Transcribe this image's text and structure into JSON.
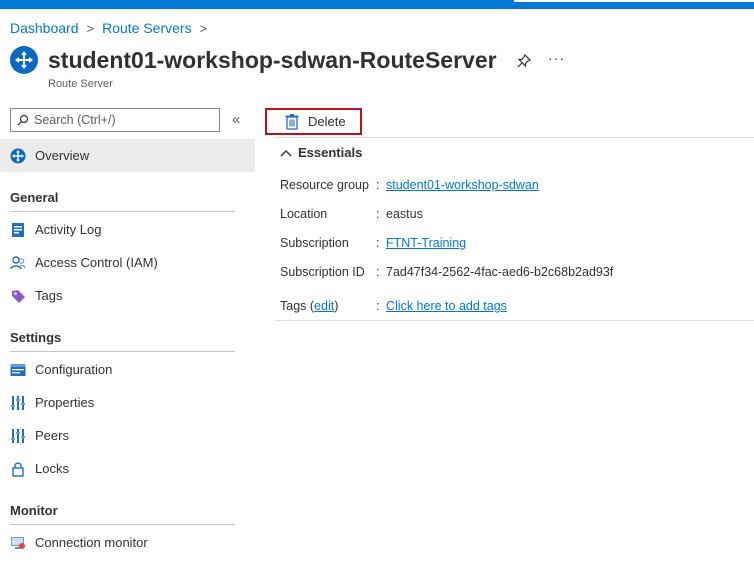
{
  "breadcrumb": {
    "items": [
      "Dashboard",
      "Route Servers"
    ],
    "separator": ">"
  },
  "resource": {
    "title": "student01-workshop-sdwan-RouteServer",
    "type": "Route Server",
    "icon": "route-server-icon",
    "more": "···"
  },
  "search": {
    "placeholder": "Search (Ctrl+/)",
    "collapse": "«"
  },
  "toolbar": {
    "delete_label": "Delete"
  },
  "nav": {
    "overview": "Overview",
    "sections": {
      "general": "General",
      "settings": "Settings",
      "monitor": "Monitor"
    },
    "items": {
      "activity_log": "Activity Log",
      "access_control": "Access Control (IAM)",
      "tags": "Tags",
      "configuration": "Configuration",
      "properties": "Properties",
      "peers": "Peers",
      "locks": "Locks",
      "connection_monitor": "Connection monitor"
    }
  },
  "essentials": {
    "header": "Essentials",
    "colon": ":",
    "resource_group": {
      "label": "Resource group",
      "value": "student01-workshop-sdwan"
    },
    "location": {
      "label": "Location",
      "value": "eastus"
    },
    "subscription": {
      "label": "Subscription",
      "value": "FTNT-Training"
    },
    "subscription_id": {
      "label": "Subscription ID",
      "value": "7ad47f34-2562-4fac-aed6-b2c68b2ad93f"
    },
    "tags": {
      "label_prefix": "Tags (",
      "edit": "edit",
      "label_suffix": ")",
      "value": "Click here to add tags"
    }
  },
  "colors": {
    "accent": "#0078d4",
    "delete_border": "#c50f1f",
    "active_nav_bg": "#edebe9"
  }
}
